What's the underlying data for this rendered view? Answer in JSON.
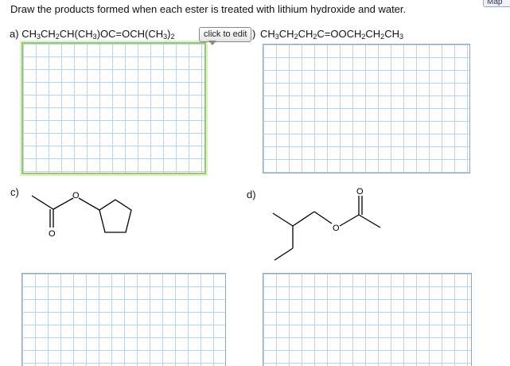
{
  "prompt": "Draw the products formed when each ester is treated with lithium hydroxide and water.",
  "parts": {
    "a": {
      "letter": "a)",
      "formula": [
        {
          "t": "CH"
        },
        {
          "s": "3"
        },
        {
          "t": "CH"
        },
        {
          "s": "2"
        },
        {
          "t": "CH(CH"
        },
        {
          "s": "3"
        },
        {
          "t": ")OC=OCH(CH"
        },
        {
          "s": "3"
        },
        {
          "t": ")"
        },
        {
          "s": "2"
        }
      ]
    },
    "b": {
      "formula": [
        {
          "t": "CH"
        },
        {
          "s": "3"
        },
        {
          "t": "CH"
        },
        {
          "s": "2"
        },
        {
          "t": "CH"
        },
        {
          "s": "2"
        },
        {
          "t": "C=OOCH"
        },
        {
          "s": "2"
        },
        {
          "t": "CH"
        },
        {
          "s": "2"
        },
        {
          "t": "CH"
        },
        {
          "s": "3"
        }
      ]
    },
    "c": {
      "letter": "c)"
    },
    "d": {
      "letter": "d)"
    }
  },
  "click_to_edit": "click to edit",
  "paren": ")",
  "map_button": "Map",
  "atom_label": "O"
}
